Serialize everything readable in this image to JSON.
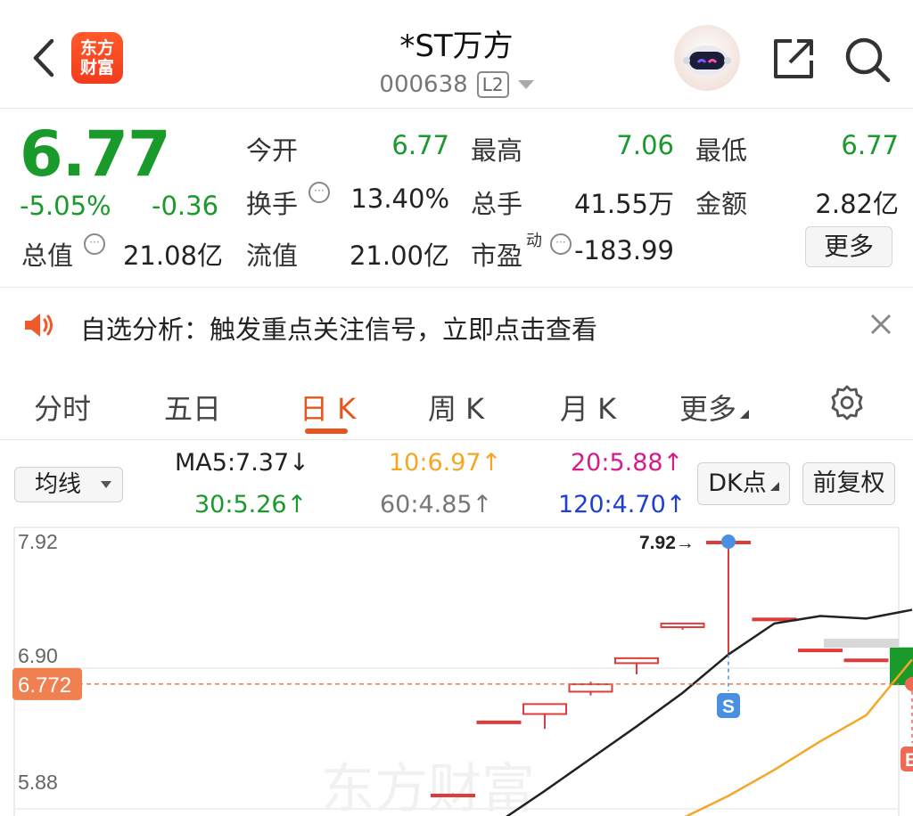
{
  "header": {
    "logo_line1": "东方",
    "logo_line2": "财富",
    "title": "*ST万方",
    "code": "000638",
    "level_badge": "L2",
    "icons": [
      "back-icon",
      "robot-avatar-icon",
      "share-icon",
      "search-icon"
    ]
  },
  "quote": {
    "price": "6.77",
    "change_pct": "-5.05%",
    "change": "-0.36",
    "rows": [
      [
        {
          "label": "今开",
          "value": "6.77"
        },
        {
          "label": "最高",
          "value": "7.06"
        },
        {
          "label": "最低",
          "value": "6.77"
        }
      ],
      [
        {
          "label": "换手",
          "value": "13.40%"
        },
        {
          "label": "总手",
          "value": "41.55万"
        },
        {
          "label": "金额",
          "value": "2.82亿"
        }
      ]
    ],
    "total_value_label": "总值",
    "total_value": "21.08亿",
    "float_label": "流值",
    "float_value": "21.00亿",
    "pe_label": "市盈",
    "pe_sup": "动",
    "pe_value": "-183.99",
    "more": "更多"
  },
  "notice": {
    "text": "自选分析：触发重点关注信号，立即点击查看"
  },
  "tabs": {
    "items": [
      "分时",
      "五日",
      "日 K",
      "周 K",
      "月 K",
      "更多"
    ],
    "active": "日 K"
  },
  "ma": {
    "select_label": "均线",
    "ma5": "MA5:7.37",
    "ma5_dir": "↓",
    "ma10": "10:6.97",
    "ma10_dir": "↑",
    "ma20": "20:5.88",
    "ma20_dir": "↑",
    "ma30": "30:5.26",
    "ma30_dir": "↑",
    "ma60": "60:4.85",
    "ma60_dir": "↑",
    "ma120": "120:4.70",
    "ma120_dir": "↑",
    "dk_button": "DK点",
    "fq_button": "前复权",
    "colors": {
      "ma5": "#222222",
      "ma10": "#f5a623",
      "ma20": "#d81b8a",
      "ma30": "#1a9a2a",
      "ma60": "#777777",
      "ma120": "#1e3fd1"
    }
  },
  "chart_data": {
    "type": "candlestick",
    "y_ticks": [
      "7.92",
      "6.90",
      "5.88"
    ],
    "ylim": [
      5.88,
      7.92
    ],
    "current_price_label": "6.772",
    "high_marker": "7.92→",
    "sell_marker": "S",
    "buy_marker": "B",
    "up_color": "#e03b3b",
    "down_color": "#1a9a2a",
    "candles": [
      {
        "open": 5.88,
        "close": 5.88,
        "high": 5.89,
        "low": 5.86
      },
      {
        "open": 6.47,
        "close": 6.47,
        "high": 6.47,
        "low": 6.47
      },
      {
        "open": 6.53,
        "close": 6.61,
        "high": 6.61,
        "low": 6.41
      },
      {
        "open": 6.71,
        "close": 6.77,
        "high": 6.79,
        "low": 6.68
      },
      {
        "open": 6.94,
        "close": 6.98,
        "high": 6.98,
        "low": 6.85
      },
      {
        "open": 7.23,
        "close": 7.26,
        "high": 7.26,
        "low": 7.21
      },
      {
        "open": 7.92,
        "close": 7.92,
        "high": 7.92,
        "low": 7.01
      },
      {
        "open": 7.3,
        "close": 7.3,
        "high": 7.3,
        "low": 7.3
      },
      {
        "open": 7.05,
        "close": 7.05,
        "high": 7.05,
        "low": 7.05
      },
      {
        "open": 6.97,
        "close": 6.97,
        "high": 6.97,
        "low": 6.97
      },
      {
        "open": 7.06,
        "close": 6.77,
        "high": 7.06,
        "low": 6.77
      }
    ],
    "ma5_line": [
      5.42,
      5.66,
      5.91,
      6.17,
      6.43,
      6.7,
      7.01,
      7.26,
      7.32,
      7.3,
      7.37
    ],
    "ma10_line": [
      null,
      null,
      null,
      null,
      null,
      5.69,
      5.87,
      6.08,
      6.31,
      6.52,
      6.97
    ]
  }
}
